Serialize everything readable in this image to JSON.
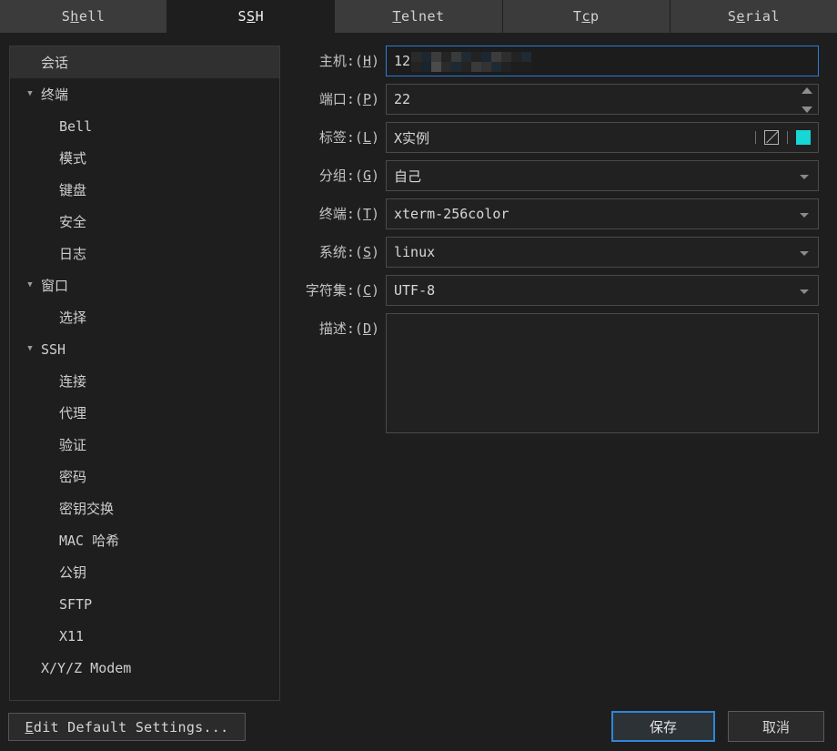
{
  "tabs": [
    {
      "pre": "S",
      "mn": "h",
      "post": "ell",
      "active": false,
      "name": "tab-shell"
    },
    {
      "pre": "S",
      "mn": "S",
      "post": "H",
      "active": true,
      "name": "tab-ssh"
    },
    {
      "pre": "",
      "mn": "T",
      "post": "elnet",
      "active": false,
      "name": "tab-telnet"
    },
    {
      "pre": "T",
      "mn": "c",
      "post": "p",
      "active": false,
      "name": "tab-tcp"
    },
    {
      "pre": "S",
      "mn": "e",
      "post": "rial",
      "active": false,
      "name": "tab-serial"
    }
  ],
  "tree": {
    "items": [
      {
        "label": "会话",
        "level": 0,
        "arrow": false,
        "selected": true,
        "name": "tree-item-session"
      },
      {
        "label": "终端",
        "level": 0,
        "arrow": true,
        "selected": false,
        "name": "tree-item-terminal"
      },
      {
        "label": "Bell",
        "level": 1,
        "arrow": false,
        "selected": false,
        "name": "tree-item-bell"
      },
      {
        "label": "模式",
        "level": 1,
        "arrow": false,
        "selected": false,
        "name": "tree-item-mode"
      },
      {
        "label": "键盘",
        "level": 1,
        "arrow": false,
        "selected": false,
        "name": "tree-item-keyboard"
      },
      {
        "label": "安全",
        "level": 1,
        "arrow": false,
        "selected": false,
        "name": "tree-item-security"
      },
      {
        "label": "日志",
        "level": 1,
        "arrow": false,
        "selected": false,
        "name": "tree-item-log"
      },
      {
        "label": "窗口",
        "level": 0,
        "arrow": true,
        "selected": false,
        "name": "tree-item-window"
      },
      {
        "label": "选择",
        "level": 1,
        "arrow": false,
        "selected": false,
        "name": "tree-item-selection"
      },
      {
        "label": "SSH",
        "level": 0,
        "arrow": true,
        "selected": false,
        "name": "tree-item-ssh"
      },
      {
        "label": "连接",
        "level": 1,
        "arrow": false,
        "selected": false,
        "name": "tree-item-connection"
      },
      {
        "label": "代理",
        "level": 1,
        "arrow": false,
        "selected": false,
        "name": "tree-item-proxy"
      },
      {
        "label": "验证",
        "level": 1,
        "arrow": false,
        "selected": false,
        "name": "tree-item-auth"
      },
      {
        "label": "密码",
        "level": 1,
        "arrow": false,
        "selected": false,
        "name": "tree-item-password"
      },
      {
        "label": "密钥交换",
        "level": 1,
        "arrow": false,
        "selected": false,
        "name": "tree-item-kex"
      },
      {
        "label": "MAC 哈希",
        "level": 1,
        "arrow": false,
        "selected": false,
        "name": "tree-item-mac-hash"
      },
      {
        "label": "公钥",
        "level": 1,
        "arrow": false,
        "selected": false,
        "name": "tree-item-public-key"
      },
      {
        "label": "SFTP",
        "level": 1,
        "arrow": false,
        "selected": false,
        "name": "tree-item-sftp"
      },
      {
        "label": "X11",
        "level": 1,
        "arrow": false,
        "selected": false,
        "name": "tree-item-x11"
      },
      {
        "label": "X/Y/Z Modem",
        "level": 0,
        "arrow": false,
        "selected": false,
        "name": "tree-item-xyz-modem"
      }
    ]
  },
  "form": {
    "host": {
      "label_pre": "主机:(",
      "label_mn": "H",
      "label_post": ")",
      "value": "12",
      "redacted": true
    },
    "port": {
      "label_pre": "端口:(",
      "label_mn": "P",
      "label_post": ")",
      "value": "22"
    },
    "label": {
      "label_pre": "标签:(",
      "label_mn": "L",
      "label_post": ")",
      "value": "X实例",
      "color": "#17d6d6"
    },
    "group": {
      "label_pre": "分组:(",
      "label_mn": "G",
      "label_post": ")",
      "value": "自己"
    },
    "terminal": {
      "label_pre": "终端:(",
      "label_mn": "T",
      "label_post": ")",
      "value": "xterm-256color"
    },
    "system": {
      "label_pre": "系统:(",
      "label_mn": "S",
      "label_post": ")",
      "value": "linux"
    },
    "charset": {
      "label_pre": "字符集:(",
      "label_mn": "C",
      "label_post": ")",
      "value": "UTF-8"
    },
    "description": {
      "label_pre": "描述:(",
      "label_mn": "D",
      "label_post": ")",
      "value": ""
    }
  },
  "footer": {
    "edit_defaults_mn": "E",
    "edit_defaults_post": "dit Default Settings...",
    "save_label": "保存",
    "cancel_label": "取消"
  },
  "mosaic": [
    [
      "#2a2a2a",
      "#1d2730",
      "#3c3c3c",
      "#242424",
      "#3a3a3a",
      "#1e2b35",
      "#222222",
      "#1b2733",
      "#3c3c3c",
      "#2e2e2e",
      "#232323",
      "#1f2a33"
    ],
    [
      "#242424",
      "#1a242d",
      "#4b4b4b",
      "#2b2b2b",
      "#1e2a33",
      "#232323",
      "#3a3a3a",
      "#333333",
      "#1f2b34",
      "#222222",
      "#1e1e1e",
      "#1e1e1e"
    ]
  ]
}
